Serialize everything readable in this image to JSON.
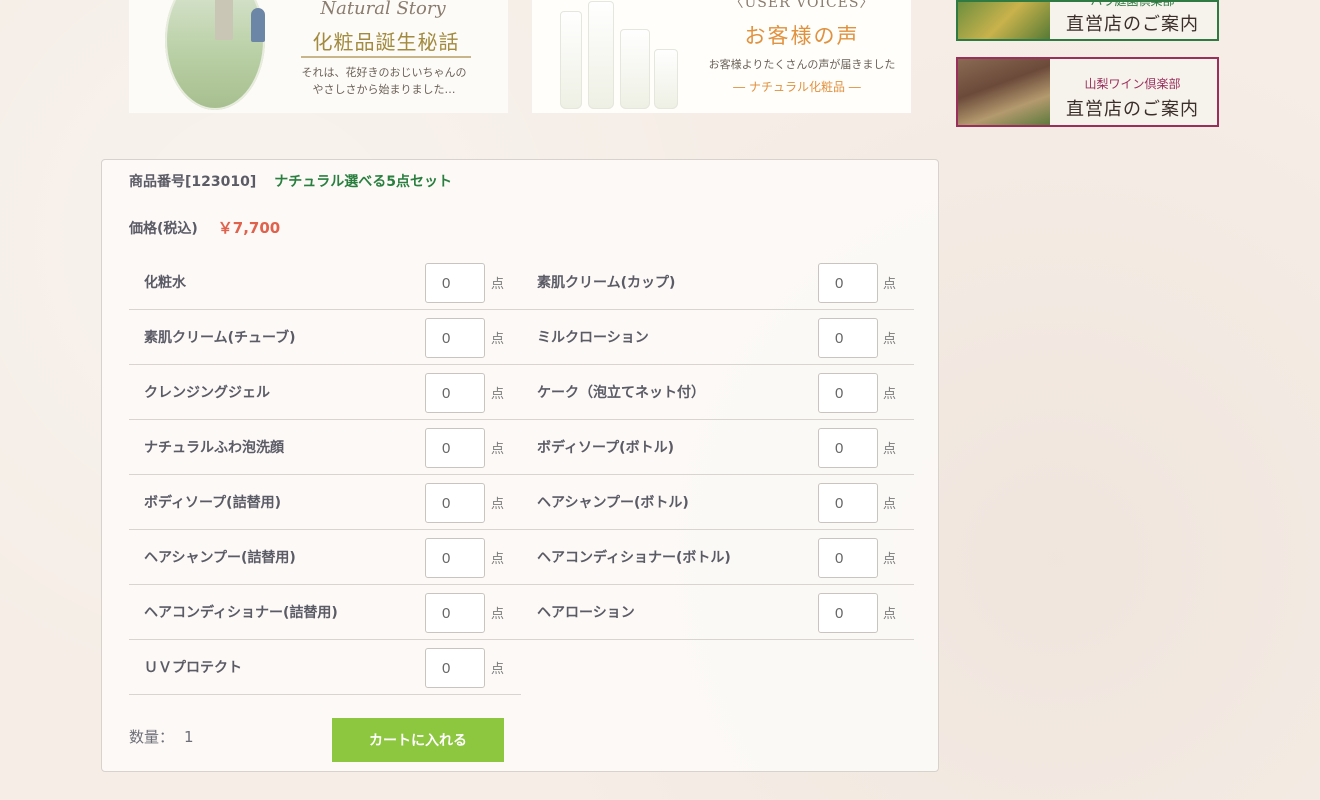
{
  "banners": {
    "story": {
      "subtitle": "Natural Story",
      "title": "化粧品誕生秘話",
      "desc_line1": "それは、花好きのおじいちゃんの",
      "desc_line2": "やさしさから始まりました…"
    },
    "voices": {
      "subtitle": "〈USER VOICES〉",
      "title": "お客様の声",
      "desc": "お客様よりたくさんの声が届きました",
      "tag": "― ナチュラル化粧品 ―"
    }
  },
  "side_banners": {
    "garden": {
      "line1": "バラ庭園倶楽部",
      "line2": "直営店のご案内"
    },
    "wine": {
      "line1": "山梨ワイン倶楽部",
      "line2": "直営店のご案内"
    }
  },
  "product": {
    "code": "商品番号[123010]",
    "name": "ナチュラル選べる5点セット",
    "price_label": "価格(税込)",
    "price_value": "￥7,700",
    "unit": "点",
    "items": [
      {
        "label": "化粧水",
        "value": "0"
      },
      {
        "label": "素肌クリーム(カップ)",
        "value": "0"
      },
      {
        "label": "素肌クリーム(チューブ)",
        "value": "0"
      },
      {
        "label": "ミルクローション",
        "value": "0"
      },
      {
        "label": "クレンジングジェル",
        "value": "0"
      },
      {
        "label": "ケーク（泡立てネット付）",
        "value": "0"
      },
      {
        "label": "ナチュラルふわ泡洗顔",
        "value": "0"
      },
      {
        "label": "ボディソープ(ボトル)",
        "value": "0"
      },
      {
        "label": "ボディソープ(詰替用)",
        "value": "0"
      },
      {
        "label": "ヘアシャンプー(ボトル)",
        "value": "0"
      },
      {
        "label": "ヘアシャンプー(詰替用)",
        "value": "0"
      },
      {
        "label": "ヘアコンディショナー(ボトル)",
        "value": "0"
      },
      {
        "label": "ヘアコンディショナー(詰替用)",
        "value": "0"
      },
      {
        "label": "ヘアローション",
        "value": "0"
      },
      {
        "label": "ＵＶプロテクト",
        "value": "0"
      }
    ],
    "quantity_label": "数量：",
    "quantity_value": "1",
    "cart_button": "カートに入れる"
  },
  "colors": {
    "accent_green": "#8dc63f",
    "product_name": "#2a7f3f",
    "price": "#e0624c"
  }
}
